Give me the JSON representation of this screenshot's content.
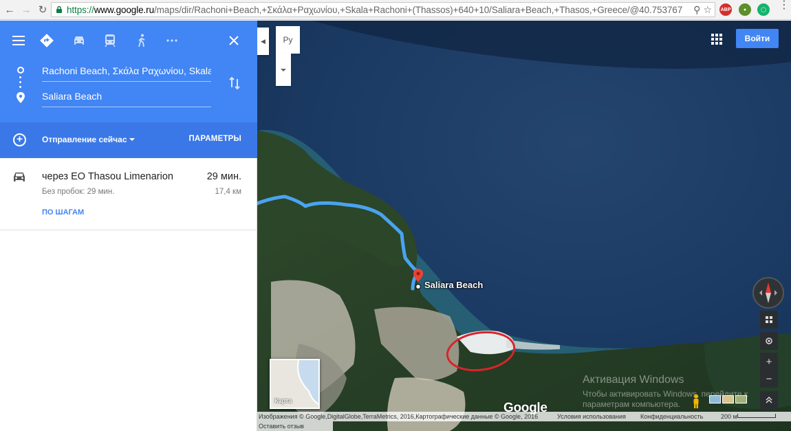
{
  "browser": {
    "url_scheme": "https://",
    "url_host": "www.google.ru",
    "url_rest": "/maps/dir/Rachoni+Beach,+Σκάλα+Ραχωνίου,+Skala+Rachoni+(Thassos)+640+10/Saliara+Beach,+Thasos,+Greece/@40.753767",
    "icons": [
      "back-icon",
      "forward-icon",
      "reload-icon",
      "zoom-icon",
      "star-icon",
      "adblock-icon",
      "extension-icon",
      "extension-icon-2",
      "menu-icon"
    ],
    "ext_labels": {
      "adblock": "ABP"
    }
  },
  "directions": {
    "modes": [
      "menu-icon",
      "directions-icon",
      "car-icon",
      "transit-icon",
      "walk-icon",
      "more-icon",
      "close-icon"
    ],
    "origin": "Rachoni Beach, Σκάλα Ραχωνίου, Skala Rachoni",
    "destination": "Saliara Beach",
    "depart_label": "Отправление сейчас",
    "params_label": "ПАРАМЕТРЫ",
    "route": {
      "via": "через EO Thasou Limenarion",
      "time": "29 мин.",
      "traffic": "Без пробок: 29 мин.",
      "distance": "17,4 км",
      "steps_link": "ПО ШАГАМ"
    }
  },
  "map": {
    "language_button": "Ру",
    "signin_label": "Войти",
    "place_label": "Saliara Beach",
    "minimap_label": "Карта",
    "google_logo": "Google",
    "watermark_title": "Активация Windows",
    "watermark_text": "Чтобы активировать Windows, перейдите к параметрам компьютера.",
    "attribution": "Изображения © Google,DigitalGlobe,TerraMetrics, 2016,Картографические данные © Google, 2016",
    "terms": "Условия использования",
    "privacy": "Конфиденциальность",
    "scale": "200 м",
    "feedback": "Оставить отзыв",
    "route_color": "#4aa3f0",
    "highlight_color": "#d9242a"
  },
  "colors": {
    "header_blue": "#4285f4",
    "depart_blue": "#3b78e7"
  }
}
